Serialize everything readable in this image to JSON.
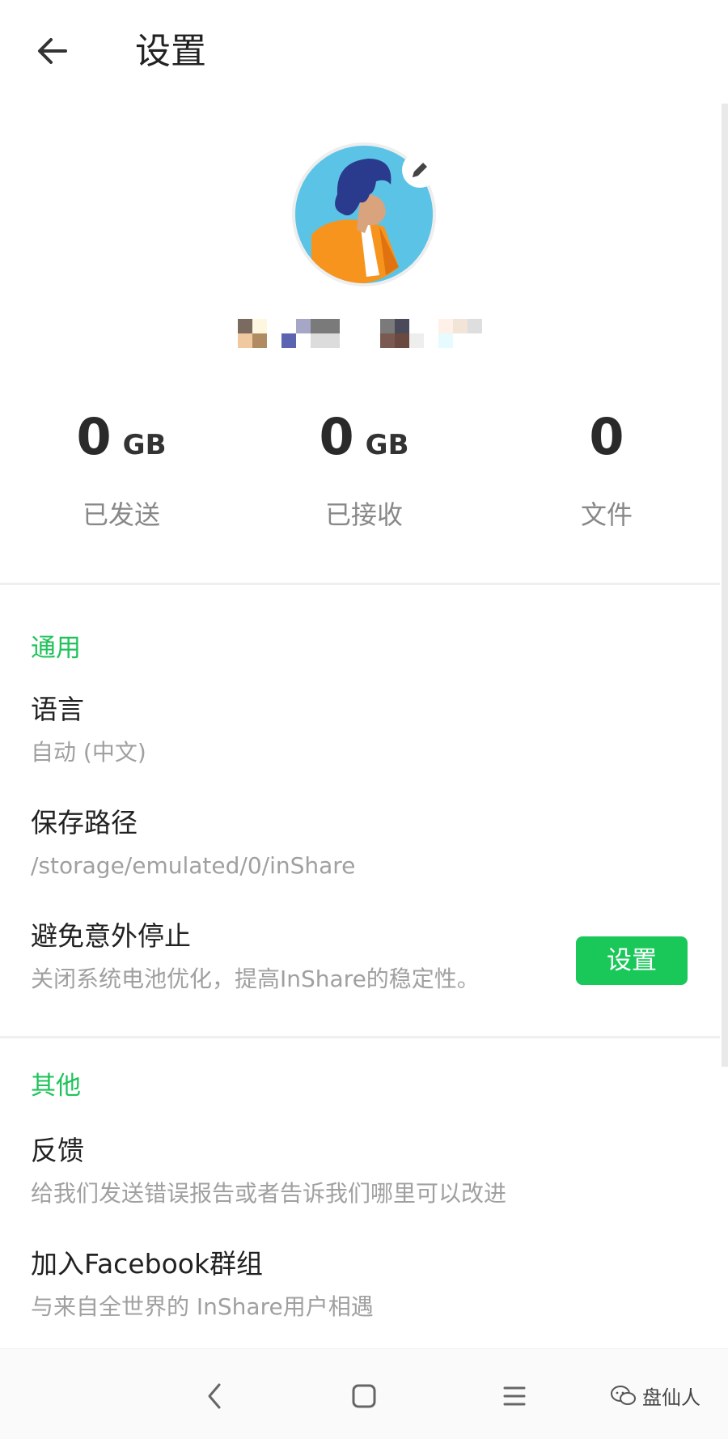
{
  "header": {
    "title": "设置"
  },
  "stats": [
    {
      "value": "0",
      "unit": "GB",
      "label": "已发送"
    },
    {
      "value": "0",
      "unit": "GB",
      "label": "已接收"
    },
    {
      "value": "0",
      "unit": "",
      "label": "文件"
    }
  ],
  "general": {
    "title": "通用",
    "language": {
      "title": "语言",
      "value": "自动 (中文)"
    },
    "save_path": {
      "title": "保存路径",
      "value": "/storage/emulated/0/inShare"
    },
    "avoid_stop": {
      "title": "避免意外停止",
      "desc": "关闭系统电池优化，提高InShare的稳定性。",
      "button": "设置"
    }
  },
  "other": {
    "title": "其他",
    "feedback": {
      "title": "反馈",
      "desc": "给我们发送错误报告或者告诉我们哪里可以改进"
    },
    "facebook": {
      "title": "加入Facebook群组",
      "desc": "与来自全世界的 InShare用户相遇"
    }
  },
  "watermark": {
    "text": "盘仙人"
  },
  "icons": {
    "back": "arrow-left-icon",
    "edit": "pencil-icon",
    "nav_back": "chevron-left-icon",
    "nav_home": "square-icon",
    "nav_menu": "menu-lines-icon"
  },
  "colors": {
    "accent": "#1fc35a",
    "button": "#1ac85a",
    "avatar_bg": "#5bc4e6"
  }
}
